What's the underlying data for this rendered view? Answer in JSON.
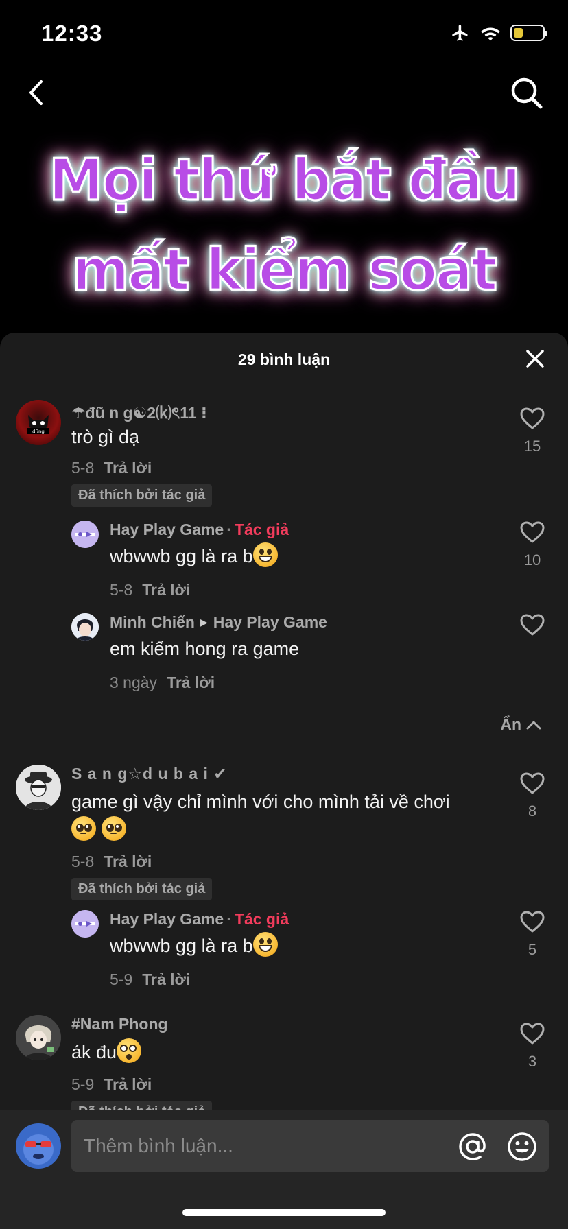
{
  "status_bar": {
    "time": "12:33",
    "battery_color": "#f2d23c"
  },
  "nav": {
    "back_icon": "chevron-left-icon",
    "search_icon": "search-icon"
  },
  "video": {
    "title_line1": "Mọi thứ bắt đầu",
    "title_line2": "mất kiểm soát"
  },
  "sheet": {
    "title": "29 bình luận"
  },
  "comments": [
    {
      "user": "☂đũ n g☯2⒦ৎ11 ⁝",
      "text": "trò gì dạ",
      "date": "5-8",
      "reply": "Trả lời",
      "liked_by_author": "Đã thích bởi tác giả",
      "likes": "15",
      "replies": [
        {
          "user": "Hay Play Game",
          "badge": "Tác giả",
          "text": "wbwwb gg là ra b",
          "emoji": "grinning-face",
          "date": "5-8",
          "reply": "Trả lời",
          "likes": "10"
        },
        {
          "user": "Minh Chiến",
          "reply_to": "Hay Play Game",
          "text": "em kiếm hong ra game",
          "date": "3 ngày",
          "reply": "Trả lời",
          "likes": ""
        }
      ],
      "hide_label": "Ẩn"
    },
    {
      "user": "S a n g☆d u b a i ✔",
      "text": "game gì vậy chỉ mình với cho mình tải về chơi",
      "emoji": "pleading-face",
      "date": "5-8",
      "reply": "Trả lời",
      "liked_by_author": "Đã thích bởi tác giả",
      "likes": "8",
      "replies": [
        {
          "user": "Hay Play Game",
          "badge": "Tác giả",
          "text": "wbwwb gg là ra b",
          "emoji": "grinning-face",
          "date": "5-9",
          "reply": "Trả lời",
          "likes": "5"
        }
      ]
    },
    {
      "user": "#Nam Phong",
      "text": "ák đu",
      "emoji": "flushed-face",
      "date": "5-9",
      "reply": "Trả lời",
      "liked_by_author": "Đã thích bởi tác giả",
      "likes": "3"
    }
  ],
  "input": {
    "placeholder": "Thêm bình luận...",
    "mention_icon": "at-sign-icon",
    "emoji_icon": "smiley-icon"
  },
  "colors": {
    "sheet_bg": "#1c1c1c",
    "author_badge": "#f23c5c",
    "input_bg": "#3a3a3a"
  }
}
